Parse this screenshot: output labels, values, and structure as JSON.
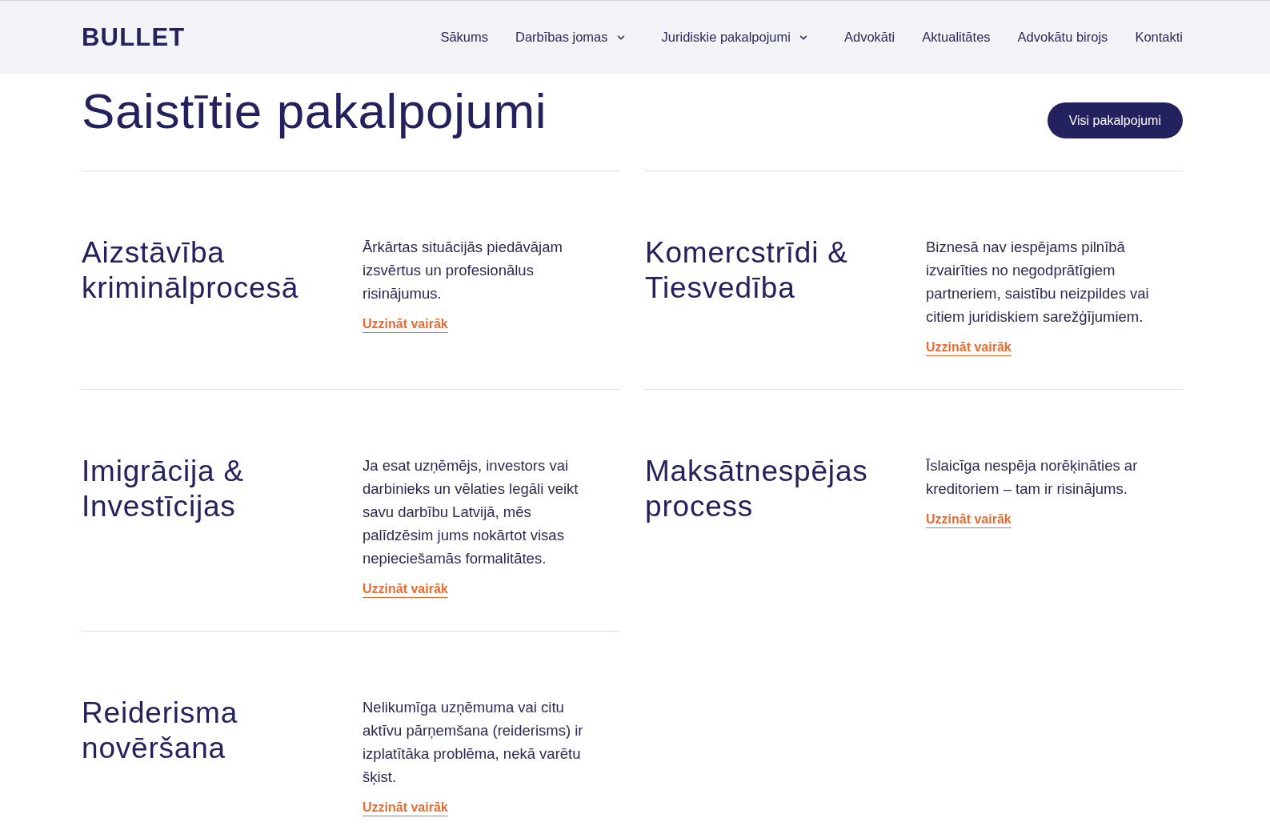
{
  "header": {
    "logo": "BULLET",
    "nav": [
      {
        "label": "Sākums",
        "dropdown": false
      },
      {
        "label": "Darbības jomas",
        "dropdown": true
      },
      {
        "label": "Juridiskie pakalpojumi",
        "dropdown": true
      },
      {
        "label": "Advokāti",
        "dropdown": false
      },
      {
        "label": "Aktualitātes",
        "dropdown": false
      },
      {
        "label": "Advokātu birojs",
        "dropdown": false
      },
      {
        "label": "Kontakti",
        "dropdown": false
      }
    ]
  },
  "section": {
    "title": "Saistītie pakalpojumi",
    "button": "Visi pakalpojumi",
    "services": [
      {
        "title": "Aizstāvība kriminālprocesā",
        "description": "Ārkārtas situācijās piedāvājam izsvērtus un profesionālus risinājumus.",
        "link": "Uzzināt vairāk"
      },
      {
        "title": "Komercstrīdi & Tiesvedība",
        "description": "Biznesā nav iespējams pilnībā izvairīties no negodprātīgiem partneriem, saistību neizpildes vai citiem juridiskiem sarežģījumiem.",
        "link": "Uzzināt vairāk"
      },
      {
        "title": "Imigrācija & Investīcijas",
        "description": "Ja esat uzņēmējs, investors vai darbinieks un vēlaties legāli veikt savu darbību Latvijā, mēs palīdzēsim jums nokārtot visas nepieciešamās formalitātes.",
        "link": "Uzzināt vairāk"
      },
      {
        "title": "Maksātnespējas process",
        "description": "Īslaicīga nespēja norēķināties ar kreditoriem – tam ir risinājums.",
        "link": "Uzzināt vairāk"
      },
      {
        "title": "Reiderisma novēršana",
        "description": "Nelikumīga uzņēmuma vai citu aktīvu pārņemšana (reiderisms) ir izplatītāka problēma, nekā varētu šķist.",
        "link": "Uzzināt vairāk"
      }
    ]
  }
}
